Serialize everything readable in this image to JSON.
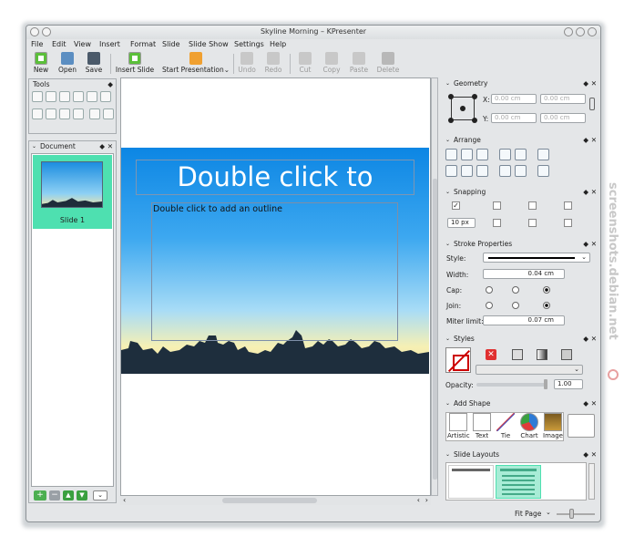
{
  "window": {
    "title": "Skyline Morning – KPresenter"
  },
  "menu": [
    "File",
    "Edit",
    "View",
    "Insert",
    "Format",
    "Slide",
    "Slide Show",
    "Settings",
    "Help"
  ],
  "toolbar": {
    "new": "New",
    "open": "Open",
    "save": "Save",
    "insert_slide": "Insert Slide",
    "start_presentation": "Start Presentation",
    "undo": "Undo",
    "redo": "Redo",
    "cut": "Cut",
    "copy": "Copy",
    "paste": "Paste",
    "delete": "Delete"
  },
  "docks": {
    "tools": "Tools",
    "document": "Document",
    "geometry": "Geometry",
    "arrange": "Arrange",
    "snapping": "Snapping",
    "stroke": "Stroke Properties",
    "styles": "Styles",
    "add_shape": "Add Shape",
    "slide_layouts": "Slide Layouts"
  },
  "document": {
    "slides": [
      {
        "label": "Slide 1"
      }
    ]
  },
  "slide": {
    "title_placeholder": "Double click to",
    "outline_placeholder": "Double click to add an outline"
  },
  "geometry": {
    "x_label": "X:",
    "y_label": "Y:",
    "x_value": "0.00 cm",
    "y_value": "0.00 cm",
    "w_value": "0.00 cm",
    "h_value": "0.00 cm"
  },
  "snapping": {
    "distance": "10 px"
  },
  "stroke": {
    "style_label": "Style:",
    "width_label": "Width:",
    "width_value": "0.04 cm",
    "cap_label": "Cap:",
    "join_label": "Join:",
    "miter_label": "Miter limit:",
    "miter_value": "0.07 cm"
  },
  "styles": {
    "opacity_label": "Opacity:",
    "opacity_value": "1.00"
  },
  "shapes": [
    "Artistic",
    "Text",
    "Tie",
    "Chart",
    "Image"
  ],
  "status": {
    "zoom": "Fit Page"
  },
  "watermark": "screenshots.debian.net",
  "colors": {
    "selection": "#4ee0b0",
    "slide_sky": "#0c86e4"
  }
}
